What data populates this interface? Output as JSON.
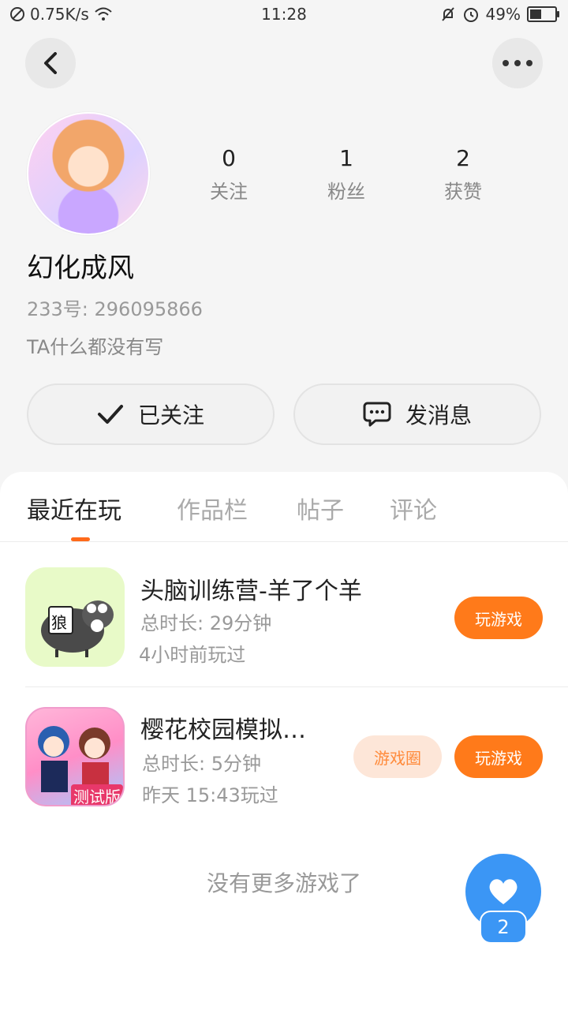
{
  "status_bar": {
    "speed": "0.75K/s",
    "time": "11:28",
    "battery": "49%",
    "battery_level": 0.49
  },
  "profile": {
    "name": "幻化成风",
    "uid_text": "233号: 296095866",
    "bio": "TA什么都没有写",
    "stats": [
      {
        "value": "0",
        "label": "关注"
      },
      {
        "value": "1",
        "label": "粉丝"
      },
      {
        "value": "2",
        "label": "获赞"
      }
    ],
    "follow_label": "已关注",
    "message_label": "发消息"
  },
  "tabs": [
    {
      "label": "最近在玩",
      "active": true
    },
    {
      "label": "作品栏",
      "active": false
    },
    {
      "label": "帖子",
      "active": false
    },
    {
      "label": "评论",
      "active": false
    }
  ],
  "games": [
    {
      "title": "头脑训练营-羊了个羊",
      "duration": "总时长: 29分钟",
      "last_played": "4小时前玩过",
      "play_label": "玩游戏",
      "icon_text": "狼"
    },
    {
      "title": "樱花校园模拟…",
      "duration": "总时长: 5分钟",
      "last_played": "昨天 15:43玩过",
      "circle_label": "游戏圈",
      "play_label": "玩游戏",
      "icon_text": "测试版"
    }
  ],
  "no_more": "没有更多游戏了",
  "like": {
    "count": "2"
  },
  "colors": {
    "accent": "#ff7a1a",
    "like_blue": "#3b96f5"
  }
}
